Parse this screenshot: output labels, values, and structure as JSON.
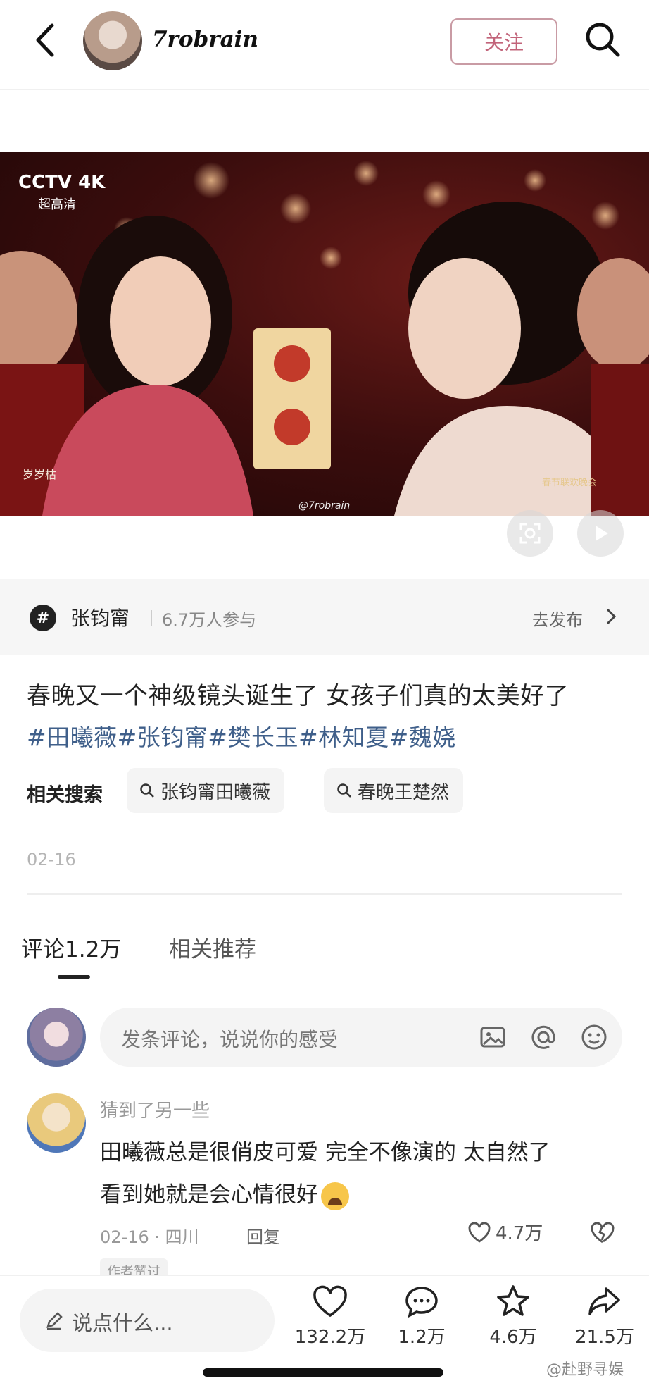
{
  "header": {
    "username": "7robrain",
    "follow_label": "关注"
  },
  "video": {
    "channel_logo": "CCTV 4K",
    "channel_sub": "超高清",
    "caption_overlay": "岁岁枯",
    "watermark": "@7robrain",
    "program_watermark": "春节联欢晚会"
  },
  "topic": {
    "name": "张钧甯",
    "participants": "6.7万人参与",
    "publish_label": "去发布"
  },
  "post": {
    "caption": "春晚又一个神级镜头诞生了 女孩子们真的太美好了",
    "hashtags": "#田曦薇#张钧甯#樊长玉#林知夏#魏娆",
    "related_label": "相关搜索",
    "related": [
      "张钧甯田曦薇",
      "春晚王楚然"
    ],
    "date": "02-16"
  },
  "tabs": {
    "comments": "评论1.2万",
    "recommend": "相关推荐"
  },
  "comment_input": {
    "placeholder": "发条评论，说说你的感受"
  },
  "comment": {
    "user": "猜到了另一些",
    "line1": "田曦薇总是很俏皮可爱 完全不像演的 太自然了",
    "line2": "看到她就是会心情很好",
    "meta": "02-16 · 四川",
    "reply_label": "回复",
    "likes": "4.7万",
    "badge": "作者赞过"
  },
  "bottom_bar": {
    "say_placeholder": "说点什么...",
    "likes": "132.2万",
    "comments": "1.2万",
    "favorites": "4.6万",
    "shares": "21.5万"
  },
  "corner_watermark": "@赴野寻娱",
  "colors": {
    "follow_text": "#c2647a",
    "hashtag": "#3f5f8a",
    "muted": "#999999"
  }
}
